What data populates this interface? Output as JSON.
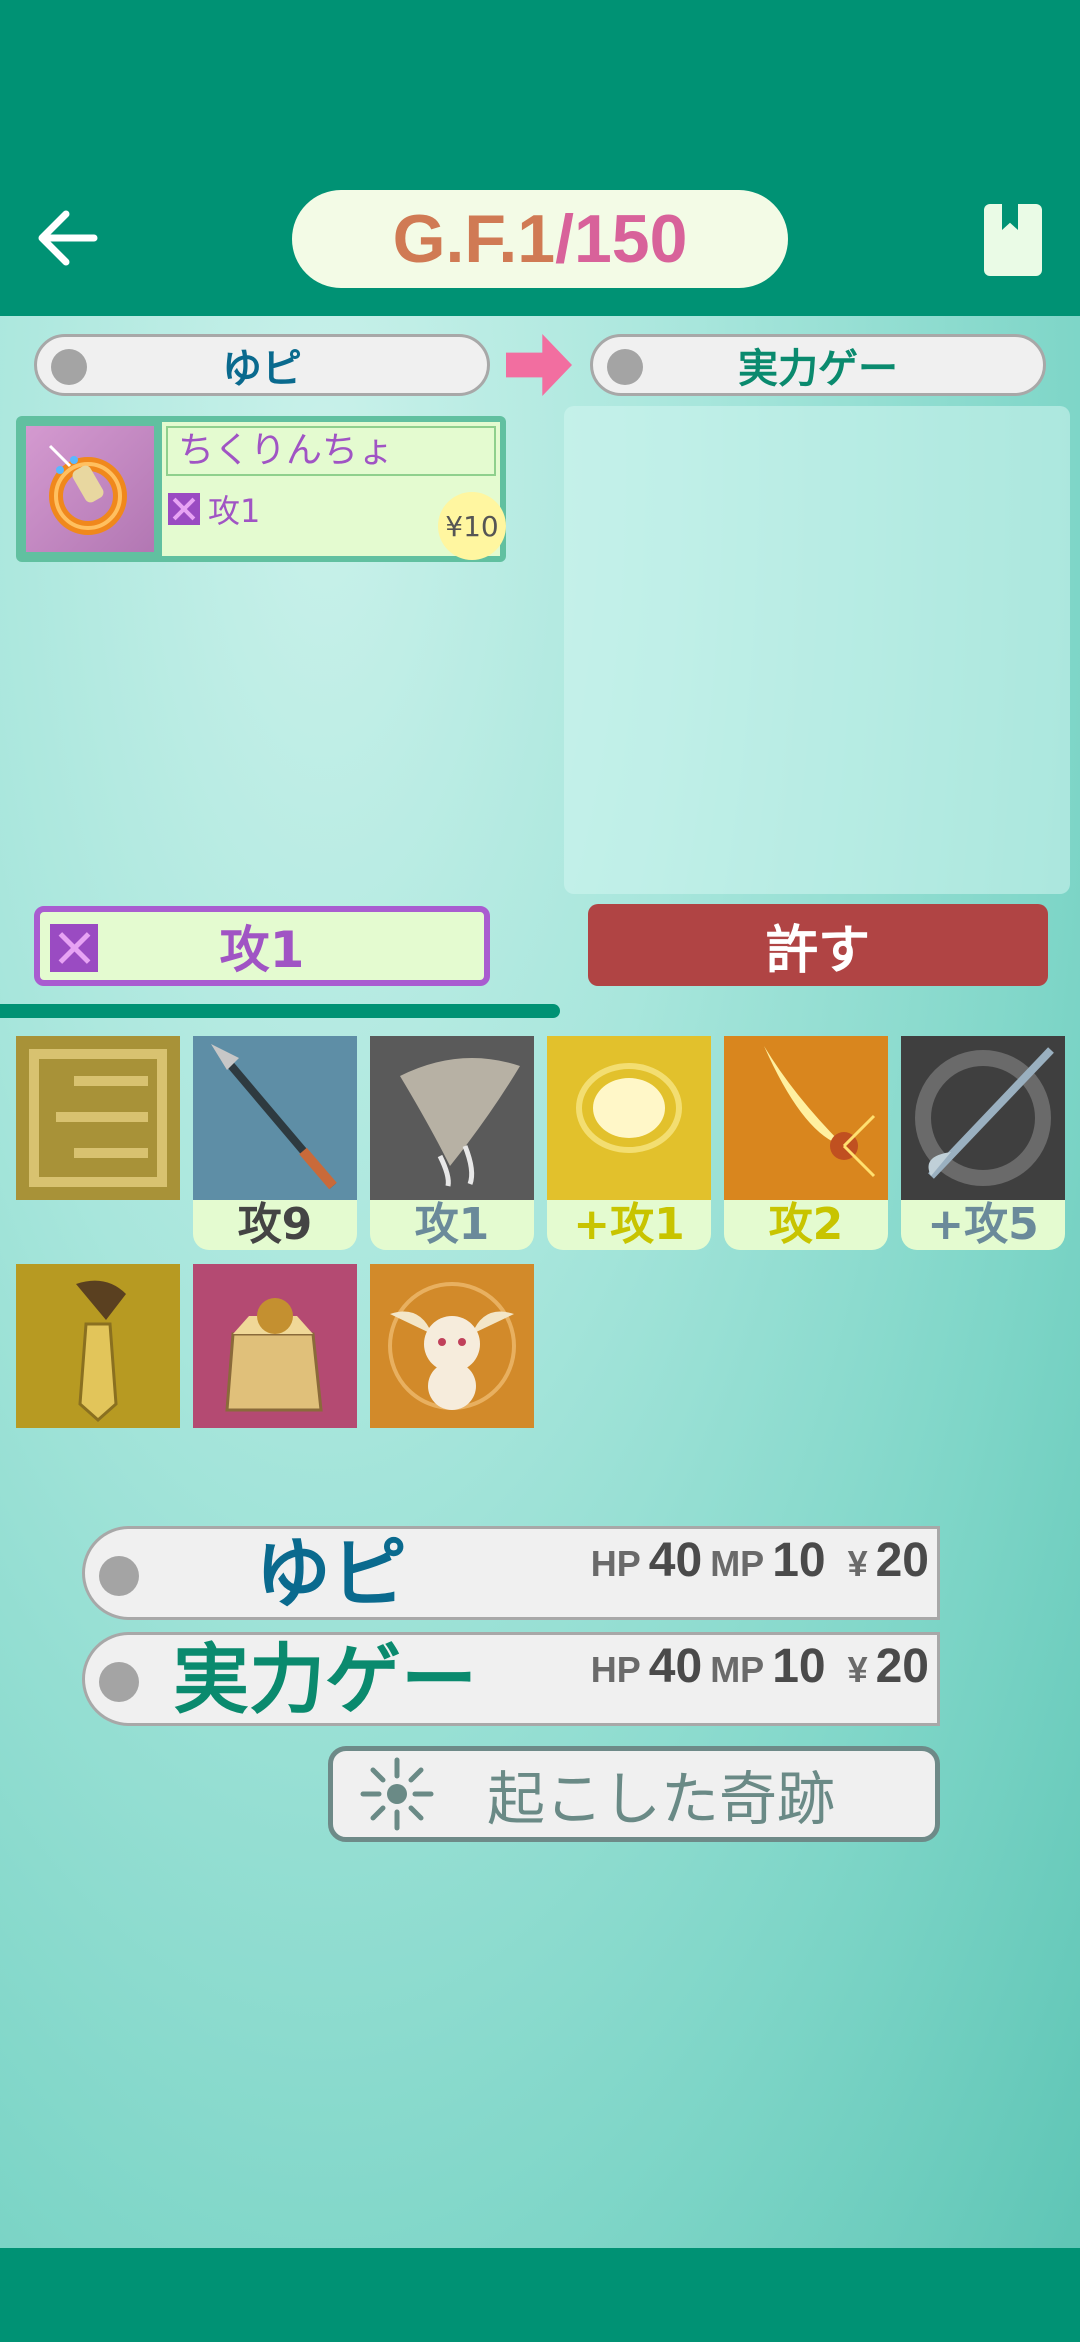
{
  "header": {
    "title_prefix": "G.F.1",
    "title_suffix": " /150",
    "back_icon": "arrow-left-icon",
    "book_icon": "bookmark-book-icon"
  },
  "players": {
    "from": "ゆピ",
    "to": "実力ゲー"
  },
  "item": {
    "name": "ちくりんちょ",
    "effect": "攻1",
    "price": "¥10"
  },
  "action": {
    "effect_label": "攻1",
    "forgive_label": "許す"
  },
  "cards": [
    {
      "label": "",
      "color": "#ffffff"
    },
    {
      "label": "攻9",
      "color": "#444444"
    },
    {
      "label": "攻1",
      "color": "#6a8a9a"
    },
    {
      "label": "+攻1",
      "color": "#c8c400"
    },
    {
      "label": "攻2",
      "color": "#c8c400"
    },
    {
      "label": "+攻5",
      "color": "#6a8a9a"
    },
    {
      "label": "",
      "color": "#ffffff"
    },
    {
      "label": "",
      "color": "#ffffff"
    },
    {
      "label": "",
      "color": "#ffffff"
    }
  ],
  "status": [
    {
      "name": "ゆピ",
      "name_color": "#0a6a8e",
      "hp_label": "HP",
      "hp": "40",
      "mp_label": "MP",
      "mp": "10",
      "yen_label": "¥",
      "yen": "20"
    },
    {
      "name": "実力ゲー",
      "name_color": "#0a8a6e",
      "hp_label": "HP",
      "hp": "40",
      "mp_label": "MP",
      "mp": "10",
      "yen_label": "¥",
      "yen": "20"
    }
  ],
  "miracle": {
    "label": "起こした奇跡"
  },
  "colors": {
    "primary": "#009274",
    "accent_pink": "#f26ea0",
    "forgive": "#b04444",
    "attack_purple": "#a054c4"
  }
}
